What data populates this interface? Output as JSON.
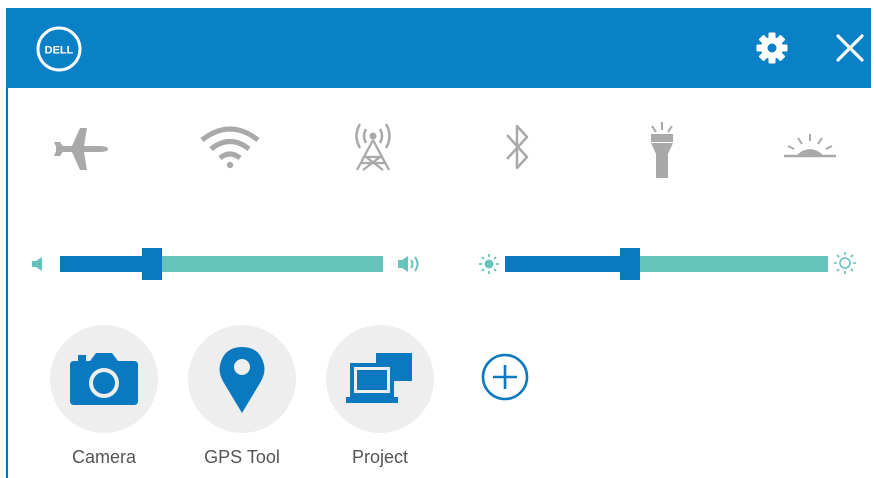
{
  "header": {
    "logo_text": "DELL",
    "settings_icon": "gear-icon",
    "close_icon": "close-icon",
    "color": "#0a81c6"
  },
  "quick_actions": [
    {
      "name": "airplane-mode",
      "icon": "airplane-icon"
    },
    {
      "name": "wifi",
      "icon": "wifi-icon"
    },
    {
      "name": "mobile-broadband",
      "icon": "cell-tower-icon"
    },
    {
      "name": "bluetooth",
      "icon": "bluetooth-icon"
    },
    {
      "name": "flashlight",
      "icon": "flashlight-icon"
    },
    {
      "name": "display-dim",
      "icon": "sunrise-icon"
    }
  ],
  "sliders": {
    "volume": {
      "level": 0.27,
      "low_icon": "volume-low-icon",
      "high_icon": "volume-high-icon"
    },
    "brightness": {
      "level": 0.38,
      "low_icon": "brightness-low-icon",
      "high_icon": "brightness-high-icon"
    }
  },
  "apps": [
    {
      "label": "Camera",
      "icon": "camera-icon"
    },
    {
      "label": "GPS Tool",
      "icon": "map-pin-icon"
    },
    {
      "label": "Project",
      "icon": "project-icon"
    }
  ],
  "add_button": {
    "icon": "plus-circle-icon"
  },
  "colors": {
    "accent": "#0a79bf",
    "track": "#66c3bc",
    "icon_gray": "#a9a9a9",
    "app_bg": "#eeeeee"
  }
}
